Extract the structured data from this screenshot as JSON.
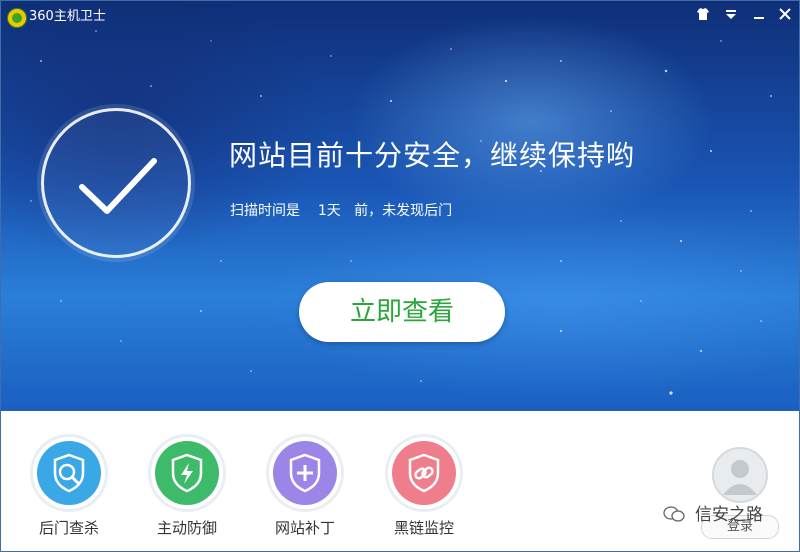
{
  "titlebar": {
    "title": "360主机卫士",
    "icons": [
      "skin-icon",
      "menu-icon",
      "minimize-icon",
      "close-icon"
    ]
  },
  "status": {
    "headline": "网站目前十分安全，继续保持哟",
    "scan_prefix": "扫描时间是",
    "scan_days": "1天",
    "scan_suffix": "前，未发现后门"
  },
  "primary_button": "立即查看",
  "tools": [
    {
      "label": "后门查杀",
      "icon": "magnifier-shield-icon",
      "color": "#3aa8e6"
    },
    {
      "label": "主动防御",
      "icon": "lightning-shield-icon",
      "color": "#3dbb6a"
    },
    {
      "label": "网站补丁",
      "icon": "plus-shield-icon",
      "color": "#9b86e8"
    },
    {
      "label": "黑链监控",
      "icon": "link-shield-icon",
      "color": "#ef7d8c"
    }
  ],
  "account": {
    "login_label": "登录"
  },
  "watermark": "信安之路",
  "colors": {
    "accent_green": "#2aa63a",
    "hero_blue": "#1a56b5"
  }
}
